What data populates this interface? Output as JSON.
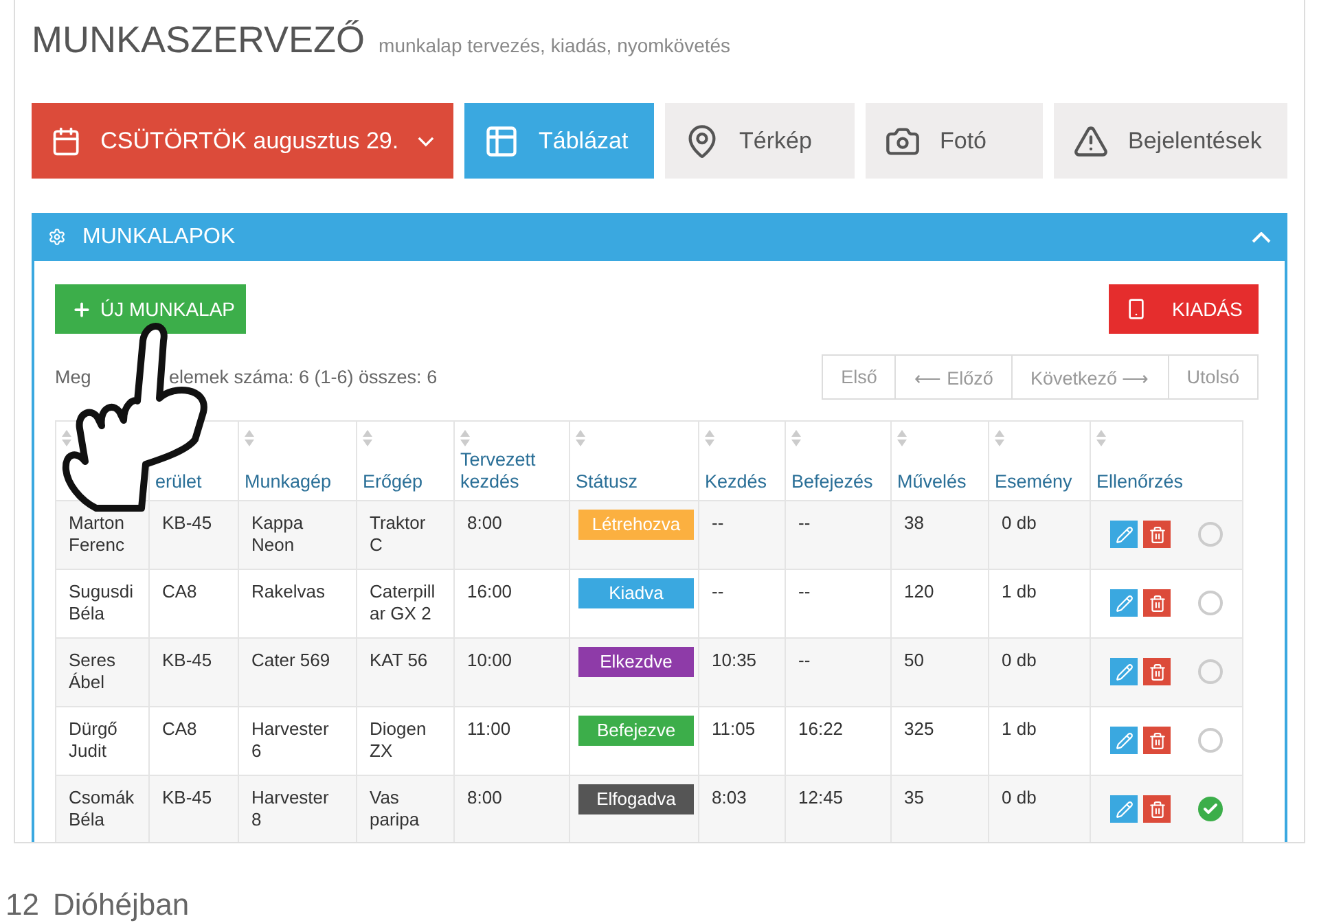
{
  "header": {
    "title": "MUNKASZERVEZŐ",
    "subtitle": "munkalap tervezés, kiadás, nyomkövetés"
  },
  "date_picker": {
    "label": "CSÜTÖRTÖK augusztus 29."
  },
  "views": [
    {
      "label": "Táblázat",
      "selected": true
    },
    {
      "label": "Térkép",
      "selected": false
    },
    {
      "label": "Fotó",
      "selected": false
    },
    {
      "label": "Bejelentések",
      "selected": false
    }
  ],
  "panel": {
    "title": "MUNKALAPOK",
    "expanded": true,
    "new_button": "ÚJ MUNKALAP",
    "issue_button": "KIADÁS",
    "info_parts": [
      "Meg",
      "elemek száma: 6 (1-6) összes: 6"
    ],
    "pager": [
      "Első",
      "⟵ Előző",
      "Következő ⟶",
      "Utolsó"
    ],
    "columns": [
      {
        "sort": true
      },
      {
        "label": "erület"
      },
      {
        "label": "Munkagép",
        "sort": true
      },
      {
        "label": "Erőgép",
        "sort": true
      },
      {
        "label": "Tervezett kezdés",
        "sort": true
      },
      {
        "label": "Státusz",
        "sort": true
      },
      {
        "label": "Kezdés",
        "sort": true
      },
      {
        "label": "Befejezés",
        "sort": true
      },
      {
        "label": "Művelés",
        "sort": true
      },
      {
        "label": "Esemény",
        "sort": true
      },
      {
        "label": "Ellenőrzés",
        "sort": true
      }
    ],
    "rows": [
      {
        "cells": [
          "Marton Ferenc",
          "KB-45",
          "Kappa Neon",
          "Traktor C",
          "8:00"
        ],
        "status": {
          "label": "Létrehozva",
          "color": "#fbb040"
        },
        "rest": [
          "--",
          "--",
          "38",
          "0 db"
        ],
        "checked": false
      },
      {
        "cells": [
          "Sugusdi Béla",
          "CA8",
          "Rakelvas",
          "Caterpillar GX 2",
          "16:00"
        ],
        "status": {
          "label": "Kiadva",
          "color": "#3aa8e0"
        },
        "rest": [
          "--",
          "--",
          "120",
          "1 db"
        ],
        "checked": false
      },
      {
        "cells": [
          "Seres Ábel",
          "KB-45",
          "Cater 569",
          "KAT 56",
          "10:00"
        ],
        "status": {
          "label": "Elkezdve",
          "color": "#8e3ba8"
        },
        "rest": [
          "10:35",
          "--",
          "50",
          "0 db"
        ],
        "checked": false
      },
      {
        "cells": [
          "Dürgő Judit",
          "CA8",
          "Harvester 6",
          "Diogen ZX",
          "11:00"
        ],
        "status": {
          "label": "Befejezve",
          "color": "#3cae4a"
        },
        "rest": [
          "11:05",
          "16:22",
          "325",
          "1 db"
        ],
        "checked": false
      },
      {
        "cells": [
          "Csomák Béla",
          "KB-45",
          "Harvester 8",
          "Vas paripa",
          "8:00"
        ],
        "status": {
          "label": "Elfogadva",
          "color": "#555555"
        },
        "rest": [
          "8:03",
          "12:45",
          "35",
          "0 db"
        ],
        "checked": true
      }
    ]
  },
  "footer": {
    "page": "12",
    "title": "Dióhéjban"
  }
}
